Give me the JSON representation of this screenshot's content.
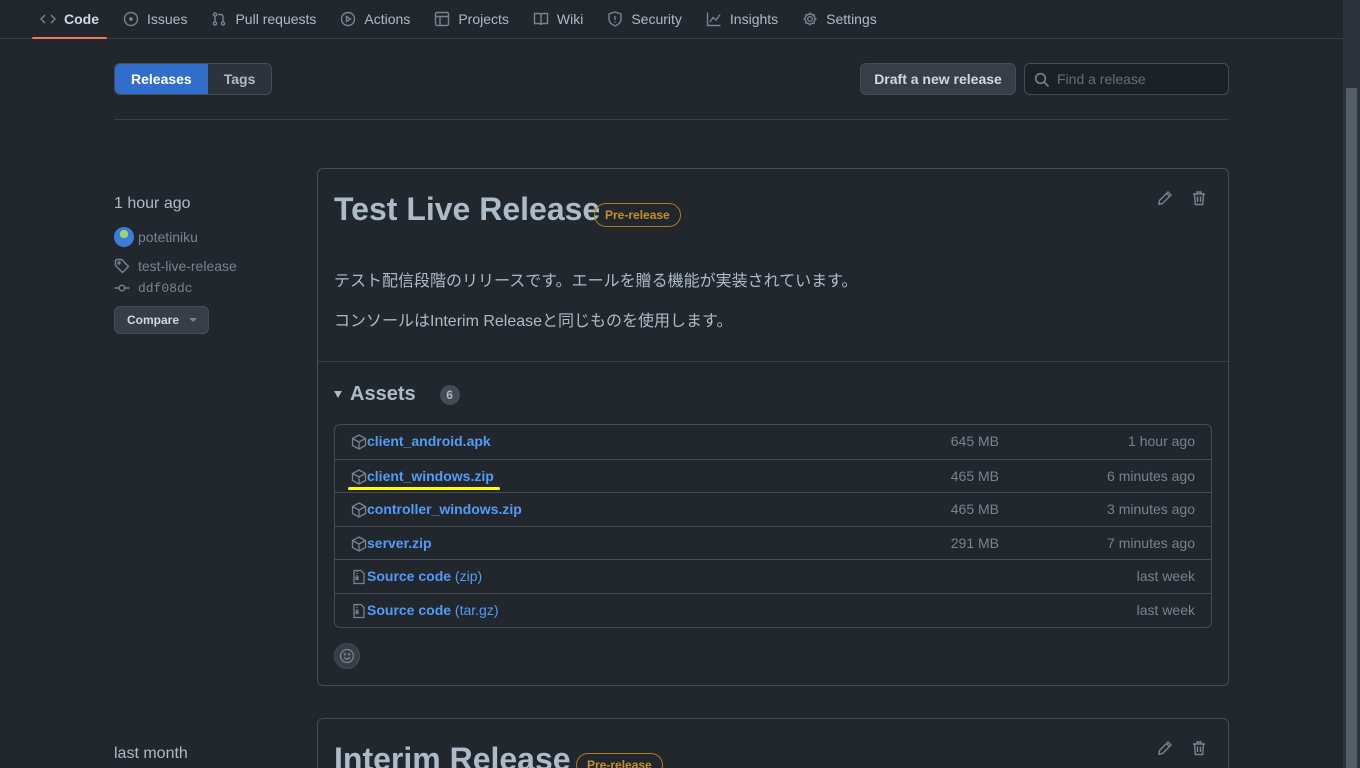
{
  "nav": {
    "tabs": [
      {
        "label": "Code"
      },
      {
        "label": "Issues"
      },
      {
        "label": "Pull requests"
      },
      {
        "label": "Actions"
      },
      {
        "label": "Projects"
      },
      {
        "label": "Wiki"
      },
      {
        "label": "Security"
      },
      {
        "label": "Insights"
      },
      {
        "label": "Settings"
      }
    ],
    "active_tab": "Code"
  },
  "subnav": {
    "releases_label": "Releases",
    "tags_label": "Tags",
    "draft_button": "Draft a new release",
    "search_placeholder": "Find a release",
    "search_value": ""
  },
  "release": {
    "time_ago": "1 hour ago",
    "author": "potetiniku",
    "tag": "test-live-release",
    "commit": "ddf08dc",
    "compare_label": "Compare",
    "title": "Test Live Release",
    "badge": "Pre-release",
    "description": [
      "テスト配信段階のリリースです。エールを贈る機能が実装されています。",
      "コンソールはInterim Releaseと同じものを使用します。"
    ],
    "assets_label": "Assets",
    "assets_count": "6",
    "assets": [
      {
        "name": "client_android.apk",
        "suffix": "",
        "size": "645 MB",
        "when": "1 hour ago",
        "icon": "package-icon"
      },
      {
        "name": "client_windows.zip",
        "suffix": "",
        "size": "465 MB",
        "when": "6 minutes ago",
        "icon": "package-icon"
      },
      {
        "name": "controller_windows.zip",
        "suffix": "",
        "size": "465 MB",
        "when": "3 minutes ago",
        "icon": "package-icon"
      },
      {
        "name": "server.zip",
        "suffix": "",
        "size": "291 MB",
        "when": "7 minutes ago",
        "icon": "package-icon"
      },
      {
        "name": "Source code",
        "suffix": " (zip)",
        "size": "",
        "when": "last week",
        "icon": "file-zip-icon"
      },
      {
        "name": "Source code",
        "suffix": " (tar.gz)",
        "size": "",
        "when": "last week",
        "icon": "file-zip-icon"
      }
    ]
  },
  "release2": {
    "time_ago": "last month",
    "title": "Interim Release",
    "badge": "Pre-release"
  },
  "colors": {
    "background": "#22272e",
    "accent": "#316dca",
    "link": "#539bf5",
    "prerelease": "#c69026",
    "highlight": "#ffff00"
  }
}
